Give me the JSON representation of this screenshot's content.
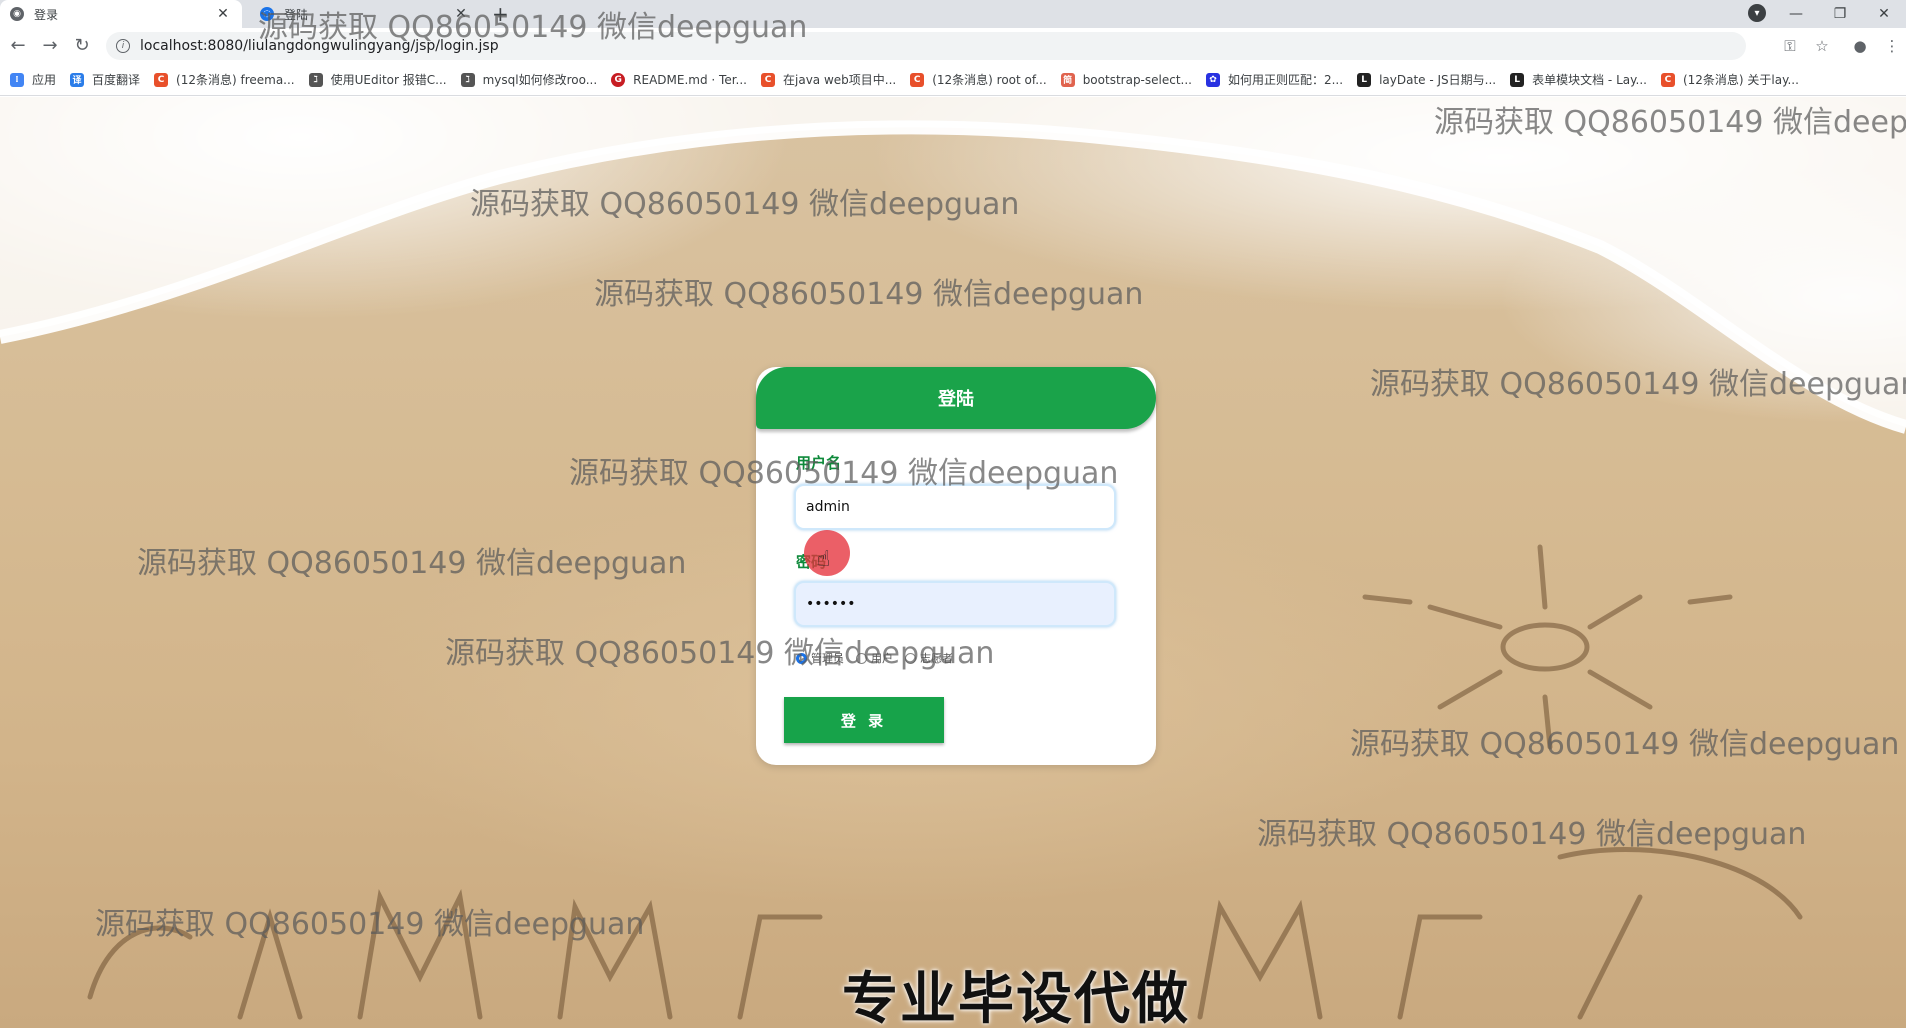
{
  "browser": {
    "tabs": [
      {
        "title": "登录",
        "active": true
      },
      {
        "title": "登陆",
        "active": false
      }
    ],
    "url": "localhost:8080/liulangdongwulingyang/jsp/login.jsp",
    "bookmarks": [
      {
        "label": "应用",
        "icon": "apps-grid-icon",
        "color": "#4285f4"
      },
      {
        "label": "百度翻译",
        "icon": "baidu-translate-icon",
        "color": "#2b7de9"
      },
      {
        "label": "(12条消息) freema...",
        "icon": "csdn-icon",
        "color": "#e8502b"
      },
      {
        "label": "使用UEditor 报错C...",
        "icon": "ueditor-icon",
        "color": "#555555"
      },
      {
        "label": "mysql如何修改roo...",
        "icon": "ueditor-icon",
        "color": "#555555"
      },
      {
        "label": "README.md · Ter...",
        "icon": "gitee-icon",
        "color": "#c71d23"
      },
      {
        "label": "在java web项目中...",
        "icon": "csdn-icon",
        "color": "#e8502b"
      },
      {
        "label": "(12条消息) root of...",
        "icon": "csdn-icon",
        "color": "#e8502b"
      },
      {
        "label": "bootstrap-select...",
        "icon": "jianshu-icon",
        "color": "#e0634e"
      },
      {
        "label": "如何用正则匹配：2...",
        "icon": "baidu-paw-icon",
        "color": "#2932e1"
      },
      {
        "label": "layDate - JS日期与...",
        "icon": "layui-icon",
        "color": "#222222"
      },
      {
        "label": "表单模块文档 - Lay...",
        "icon": "layui-icon",
        "color": "#222222"
      },
      {
        "label": "(12条消息) 关于lay...",
        "icon": "csdn-icon",
        "color": "#e8502b"
      }
    ]
  },
  "watermark_text": "源码获取 QQ86050149 微信deepguan",
  "login": {
    "title": "登陆",
    "username_label": "用户名",
    "username_value": "admin",
    "password_label": "密码",
    "password_value": "••••••",
    "roles": [
      {
        "label": "管理员",
        "checked": true
      },
      {
        "label": "用户",
        "checked": false
      },
      {
        "label": "志愿者",
        "checked": false
      }
    ],
    "submit_label": "登 录"
  },
  "promo_text": "专业毕设代做",
  "colors": {
    "accent": "#1aa34a",
    "label_green": "#0f8a3b",
    "cursor_highlight": "#e6323c"
  }
}
